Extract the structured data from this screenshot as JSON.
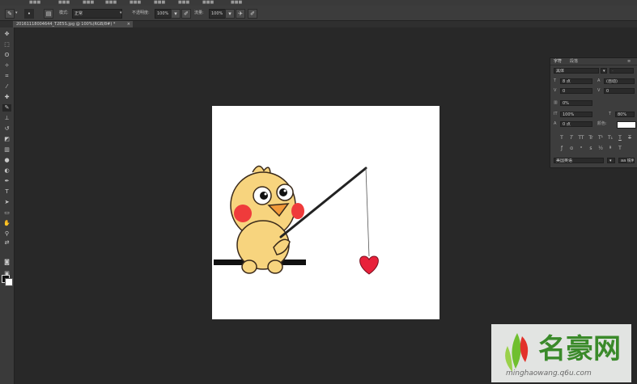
{
  "colors": {
    "workspace": "#282828",
    "canvas": "#ffffff",
    "chick_body": "#f7d47e",
    "cheek": "#ef3b3b",
    "heart": "#e8213a",
    "watermark_green": "#6fbf2e",
    "watermark_red": "#e2312a"
  },
  "options_bar": {
    "mode_label": "模式:",
    "mode_value": "正常",
    "opacity_label": "不透明度:",
    "opacity_value": "100%",
    "flow_label": "流量:",
    "flow_value": "100%"
  },
  "document_tab": {
    "title": "20161118004644_T2E5S.jpg @ 100%(RGB/8#) *",
    "close": "×"
  },
  "character_panel": {
    "tabs": [
      "字符",
      "段落"
    ],
    "font_family": "黑体",
    "font_size": "8 点",
    "leading": "(自动)",
    "kerning": "0",
    "tracking": "0",
    "vertical_scale": "0%",
    "horizontal_scale": "100%",
    "scale_v": "80%",
    "baseline": "0 点",
    "color_label": "颜色:",
    "style_buttons": [
      "T",
      "T",
      "TT",
      "Tr",
      "T¹",
      "T₁",
      "T",
      "T"
    ],
    "language": "美国英语",
    "antialias": "aa 锐利"
  },
  "watermark": {
    "name": "名豪网",
    "url": "minghaowang.q6u.com"
  }
}
